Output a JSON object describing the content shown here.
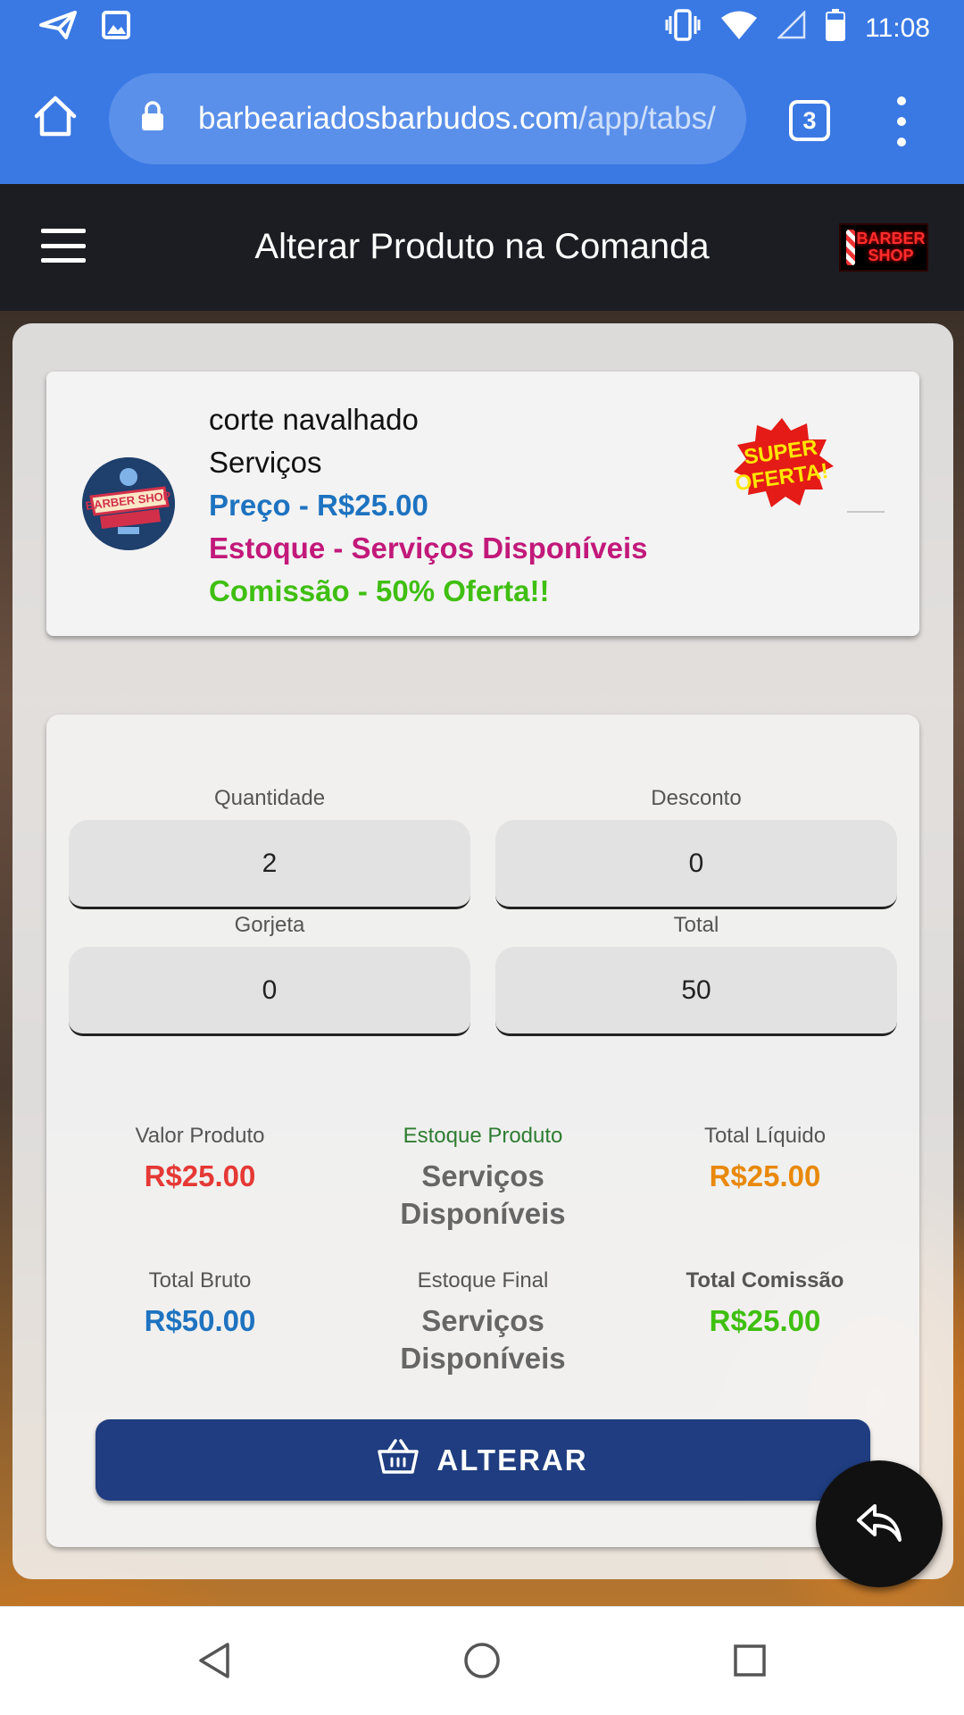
{
  "status_bar": {
    "time": "11:08",
    "left_icons": [
      "send-icon",
      "image-icon"
    ],
    "right_icons": [
      "vibrate-icon",
      "wifi-icon",
      "signal-icon",
      "battery-icon"
    ]
  },
  "browser": {
    "url_host": "barbeariadosbarbudos.com",
    "url_path": "/app/tabs/",
    "tab_count": "3"
  },
  "app": {
    "title": "Alterar Produto na Comanda",
    "logo_text": "BARBER SHOP"
  },
  "product": {
    "avatar_text": "BARBER SHOP",
    "name": "corte navalhado",
    "category": "Serviços",
    "price": "Preço - R$25.00",
    "stock": "Estoque - Serviços Disponíveis",
    "commission": "Comissão - 50% Oferta!!",
    "badge_line1": "SUPER",
    "badge_line2": "OFERTA!"
  },
  "form": {
    "quantidade": {
      "label": "Quantidade",
      "value": "2"
    },
    "desconto": {
      "label": "Desconto",
      "value": "0"
    },
    "gorjeta": {
      "label": "Gorjeta",
      "value": "0"
    },
    "total": {
      "label": "Total",
      "value": "50"
    }
  },
  "summary": {
    "valor_produto": {
      "label": "Valor Produto",
      "value": "R$25.00",
      "color": "#e53935"
    },
    "estoque_produto": {
      "label": "Estoque Produto",
      "value": "Serviços Disponíveis",
      "color": "#666666",
      "label_color": "#2e7d32"
    },
    "total_liquido": {
      "label": "Total Líquido",
      "value": "R$25.00",
      "color": "#e8890c"
    },
    "total_bruto": {
      "label": "Total Bruto",
      "value": "R$50.00",
      "color": "#1e73c0"
    },
    "estoque_final": {
      "label": "Estoque Final",
      "value": "Serviços Disponíveis",
      "color": "#666666"
    },
    "total_comissao": {
      "label": "Total Comissão",
      "value": "R$25.00",
      "color": "#3fbf11"
    }
  },
  "actions": {
    "alterar_label": "ALTERAR",
    "alterar_color": "#1f3d80"
  },
  "nav": [
    "back-icon",
    "home-circle-icon",
    "recents-icon"
  ]
}
